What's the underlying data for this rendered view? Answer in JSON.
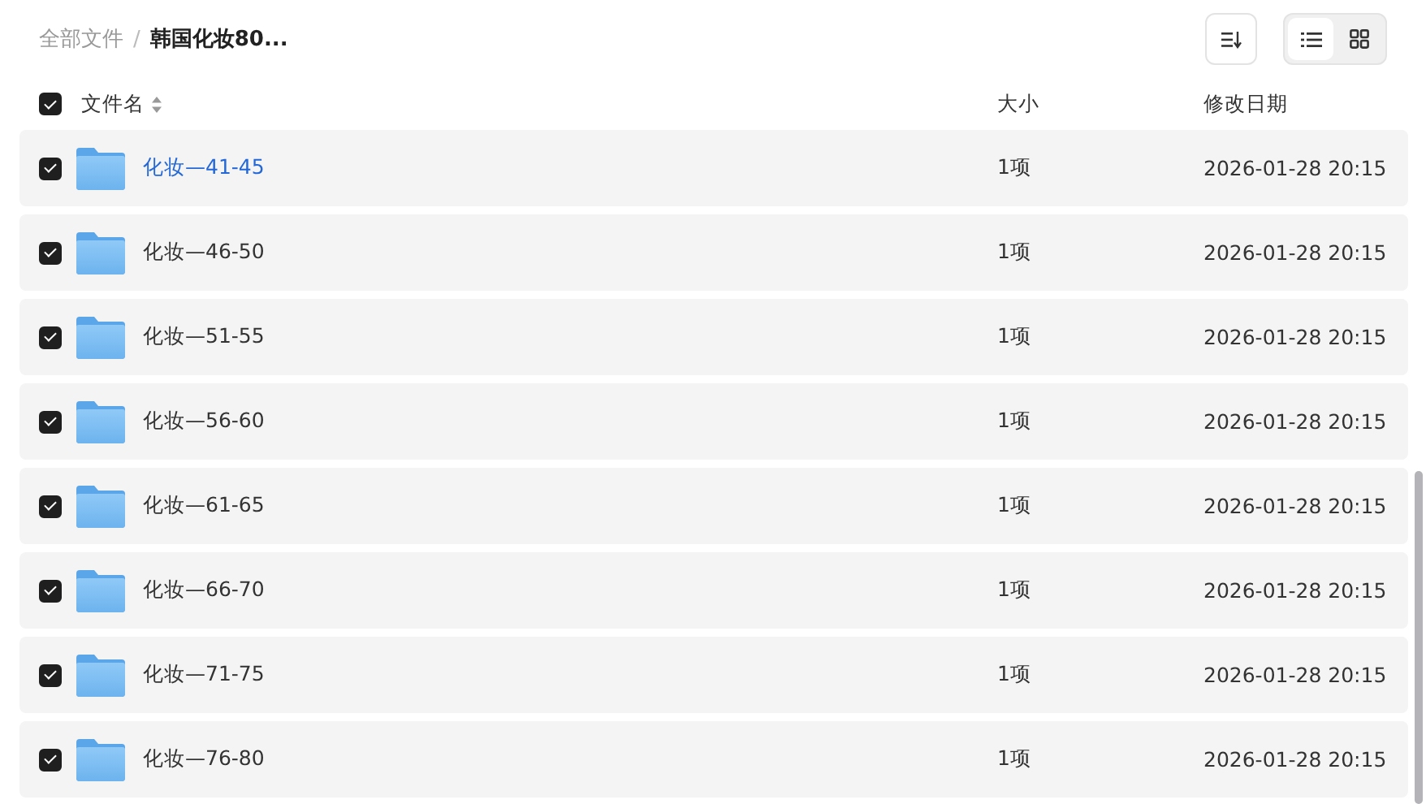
{
  "breadcrumb": {
    "separator": "/",
    "items": [
      {
        "label": "全部文件",
        "current": false
      },
      {
        "label": "韩国化妆80...",
        "current": true
      }
    ]
  },
  "view_modes": [
    {
      "kind": "list",
      "selected": true
    },
    {
      "kind": "grid",
      "selected": false
    }
  ],
  "table": {
    "select_all": {
      "checked": true
    },
    "columns": [
      {
        "label": "文件名",
        "sortable": true
      },
      {
        "label": "大小"
      },
      {
        "label": "修改日期"
      }
    ],
    "rows": [
      {
        "name": "化妆—41-45",
        "size": "1项",
        "modified": "2026-01-28 20:15",
        "checked": true,
        "highlighted": true
      },
      {
        "name": "化妆—46-50",
        "size": "1项",
        "modified": "2026-01-28 20:15",
        "checked": true,
        "highlighted": false
      },
      {
        "name": "化妆—51-55",
        "size": "1项",
        "modified": "2026-01-28 20:15",
        "checked": true,
        "highlighted": false
      },
      {
        "name": "化妆—56-60",
        "size": "1项",
        "modified": "2026-01-28 20:15",
        "checked": true,
        "highlighted": false
      },
      {
        "name": "化妆—61-65",
        "size": "1项",
        "modified": "2026-01-28 20:15",
        "checked": true,
        "highlighted": false
      },
      {
        "name": "化妆—66-70",
        "size": "1项",
        "modified": "2026-01-28 20:15",
        "checked": true,
        "highlighted": false
      },
      {
        "name": "化妆—71-75",
        "size": "1项",
        "modified": "2026-01-28 20:15",
        "checked": true,
        "highlighted": false
      },
      {
        "name": "化妆—76-80",
        "size": "1项",
        "modified": "2026-01-28 20:15",
        "checked": true,
        "highlighted": false
      }
    ]
  }
}
